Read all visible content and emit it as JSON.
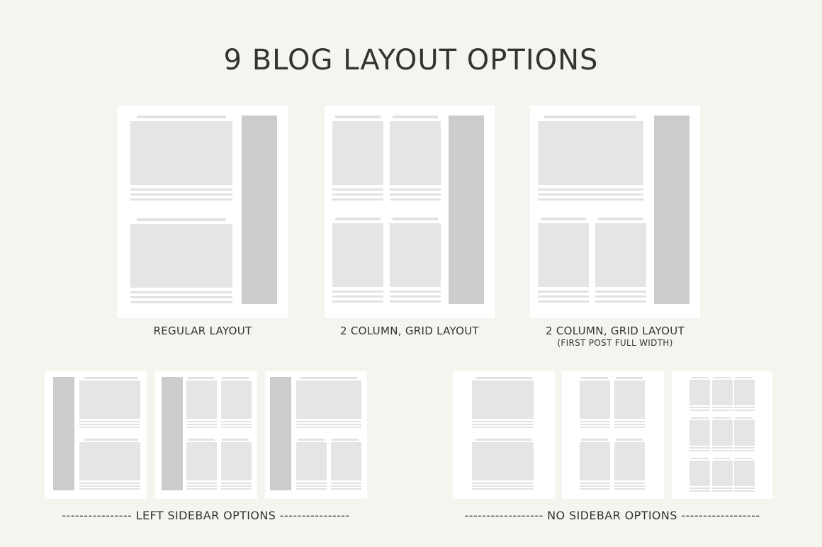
{
  "title": "9 BLOG LAYOUT OPTIONS",
  "layouts": [
    {
      "label": "REGULAR LAYOUT",
      "sublabel": ""
    },
    {
      "label": "2 COLUMN, GRID LAYOUT",
      "sublabel": ""
    },
    {
      "label": "2 COLUMN, GRID LAYOUT",
      "sublabel": "(FIRST POST FULL WIDTH)"
    }
  ],
  "sections": {
    "left_sidebar": "---------------- LEFT SIDEBAR OPTIONS ----------------",
    "no_sidebar": "------------------ NO SIDEBAR OPTIONS ------------------"
  },
  "colors": {
    "background": "#f5f5f0",
    "card": "#ffffff",
    "image_block": "#e5e5e5",
    "text_line": "#e2e2e2",
    "sidebar": "#cccccc",
    "text": "#333333"
  }
}
